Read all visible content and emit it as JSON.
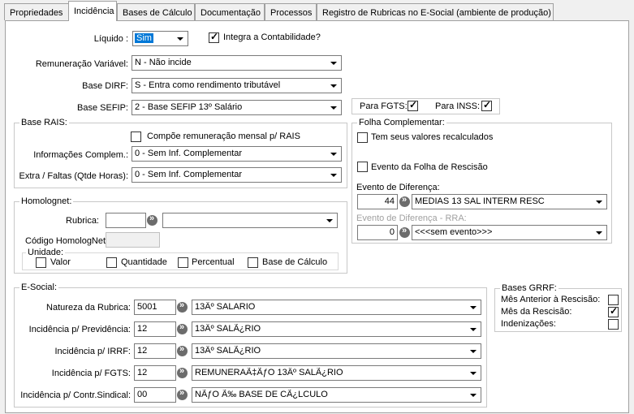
{
  "tabs": [
    "Propriedades",
    "Incidência",
    "Bases de Cálculo",
    "Documentação",
    "Processos",
    "Registro de Rubricas no E-Social (ambiente de produção)"
  ],
  "liquido": {
    "label": "Líquido :",
    "value": "Sim"
  },
  "integra": {
    "label": "Integra a Contabilidade?",
    "checked": true
  },
  "remuneracao": {
    "label": "Remuneração Variável:",
    "value": "N - Não incide"
  },
  "base_dirf": {
    "label": "Base DIRF:",
    "value": "S - Entra como rendimento tributável"
  },
  "base_sefip": {
    "label": "Base SEFIP:",
    "value": "2 - Base SEFIP 13º Salário"
  },
  "para_fgts": {
    "label": "Para FGTS:",
    "checked": true
  },
  "para_inss": {
    "label": "Para INSS:",
    "checked": true
  },
  "rais": {
    "title": "Base RAIS:",
    "compoe_label": "Compõe remuneração mensal p/ RAIS",
    "info_label": "Informações Complem.:",
    "info_value": "0 - Sem Inf. Complementar",
    "extra_label": "Extra / Faltas (Qtde Horas):",
    "extra_value": "0 - Sem Inf. Complementar"
  },
  "folha": {
    "title": "Folha Complementar:",
    "recalc_label": "Tem seus valores recalculados",
    "rescisao_label": "Evento da Folha de Rescisão",
    "diferenca_label": "Evento de Diferença:",
    "diferenca_code": "44",
    "diferenca_value": "MEDIAS 13 SAL INTERM RESC",
    "rra_label": "Evento de Diferença - RRA:",
    "rra_code": "0",
    "rra_value": "<<<sem evento>>>"
  },
  "homolognet": {
    "title": "Homolognet:",
    "rubrica_label": "Rubrica:",
    "codigo_label": "Código HomologNet",
    "unidade_title": "Unidade:",
    "unidades": [
      "Valor",
      "Quantidade",
      "Percentual",
      "Base de Cálculo"
    ]
  },
  "esocial": {
    "title": "E-Social:",
    "rows": [
      {
        "label": "Natureza da Rubrica:",
        "code": "5001",
        "value": "13Âº SALARIO"
      },
      {
        "label": "Incidência p/ Previdência:",
        "code": "12",
        "value": "13Âº SALÃ¿RIO"
      },
      {
        "label": "Incidência p/ IRRF:",
        "code": "12",
        "value": "13Âº SALÃ¿RIO"
      },
      {
        "label": "Incidência p/ FGTS:",
        "code": "12",
        "value": "REMUNERAÃ‡ÃƒO 13Âº SALÃ¿RIO"
      },
      {
        "label": "Incidência p/ Contr.Sindical:",
        "code": "00",
        "value": "NÃƒO Ã‰ BASE DE CÃ¿LCULO"
      }
    ]
  },
  "grrf": {
    "title": "Bases GRRF:",
    "items": [
      {
        "label": "Mês Anterior à Rescisão:",
        "checked": false
      },
      {
        "label": "Mês da Rescisão:",
        "checked": true
      },
      {
        "label": "Indenizações:",
        "checked": false
      }
    ]
  }
}
